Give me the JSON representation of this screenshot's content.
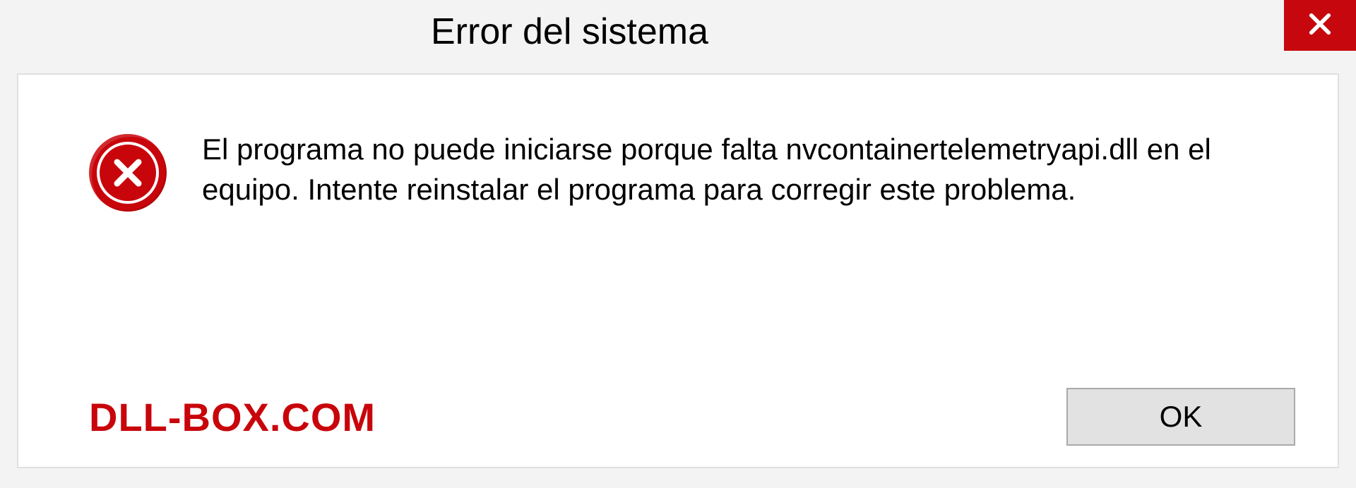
{
  "dialog": {
    "title": "Error del sistema",
    "message": "El programa no puede iniciarse porque falta nvcontainertelemetryapi.dll en el equipo. Intente reinstalar el programa para corregir este problema.",
    "ok_label": "OK",
    "watermark": "DLL-BOX.COM"
  },
  "colors": {
    "error_red": "#c8050b",
    "close_red": "#c6080e",
    "background": "#f3f3f3",
    "panel_bg": "#ffffff",
    "button_bg": "#e2e2e2",
    "button_border": "#a9a9a9"
  }
}
